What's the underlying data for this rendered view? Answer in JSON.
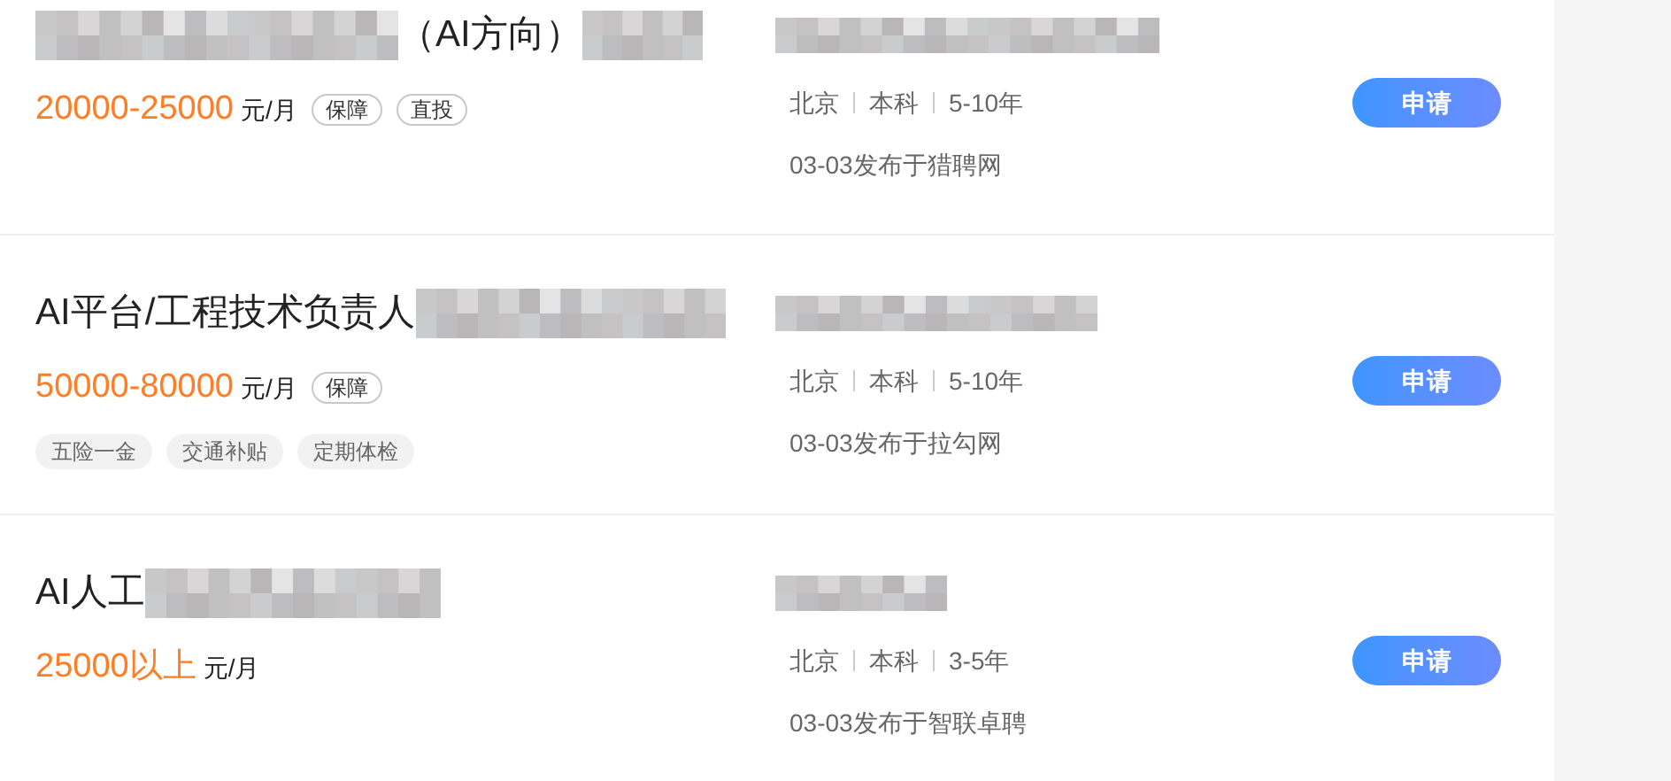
{
  "jobs": [
    {
      "title": [
        {
          "kind": "redacted"
        },
        {
          "kind": "text",
          "text": "（AI方向）"
        },
        {
          "kind": "redacted"
        }
      ],
      "salary": "20000-25000",
      "unit": "元/月",
      "badges": [
        "保障",
        "直投"
      ],
      "company": {
        "kind": "redacted"
      },
      "meta": [
        "北京",
        "本科",
        "5-10年"
      ],
      "source": "03-03发布于猎聘网",
      "button": "申请"
    },
    {
      "title": [
        {
          "kind": "text",
          "text": "AI平台/工程技术负责人"
        },
        {
          "kind": "redacted"
        }
      ],
      "salary": "50000-80000",
      "unit": "元/月",
      "badges": [
        "保障"
      ],
      "benefits": [
        "五险一金",
        "交通补贴",
        "定期体检"
      ],
      "company": {
        "kind": "redacted"
      },
      "meta": [
        "北京",
        "本科",
        "5-10年"
      ],
      "source": "03-03发布于拉勾网",
      "button": "申请"
    },
    {
      "title": [
        {
          "kind": "text",
          "text": "AI人工"
        },
        {
          "kind": "redacted"
        }
      ],
      "salary": "25000以上",
      "unit": "元/月",
      "company": {
        "kind": "redacted"
      },
      "meta": [
        "北京",
        "本科",
        "3-5年"
      ],
      "source": "03-03发布于智联卓聘",
      "button": "申请"
    }
  ]
}
